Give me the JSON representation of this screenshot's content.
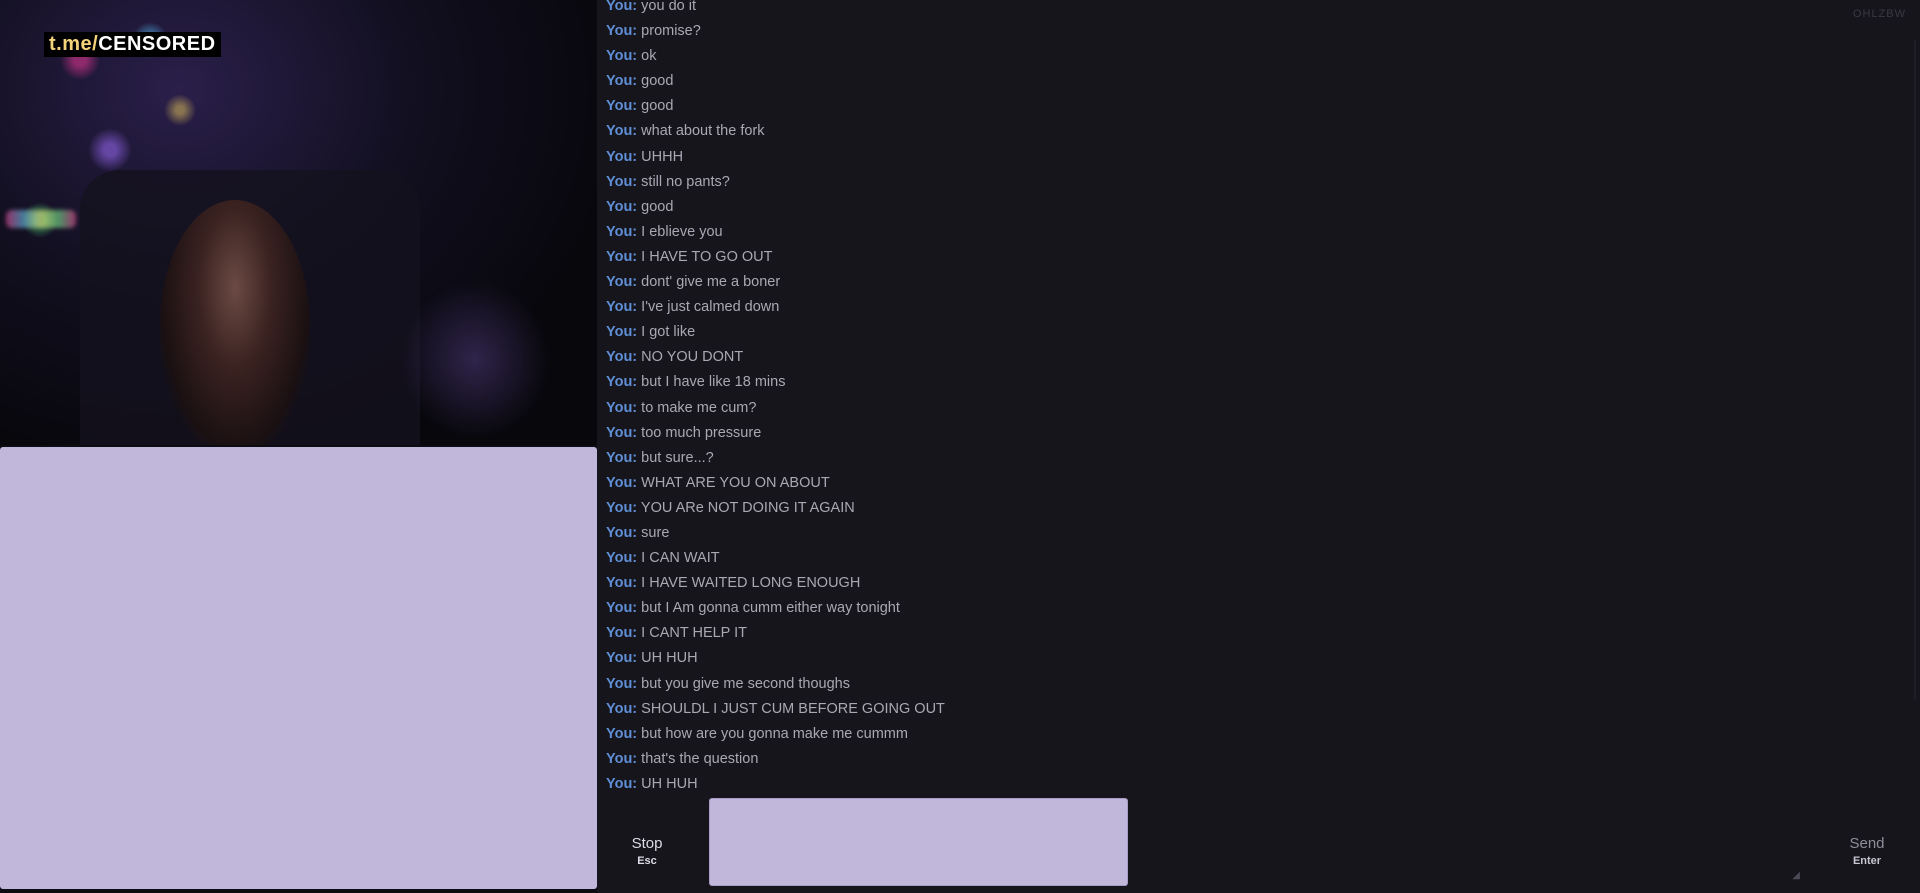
{
  "watermark": {
    "prefix": "t.me/",
    "text": "CENSORED"
  },
  "corner_text": "OHLZBW",
  "chat": {
    "messages": [
      {
        "who": "You:",
        "text": "you do it"
      },
      {
        "who": "You:",
        "text": "promise?"
      },
      {
        "who": "You:",
        "text": "ok"
      },
      {
        "who": "You:",
        "text": "good"
      },
      {
        "who": "You:",
        "text": "good"
      },
      {
        "who": "You:",
        "text": "what about the fork"
      },
      {
        "who": "You:",
        "text": "UHHH"
      },
      {
        "who": "You:",
        "text": "still no pants?"
      },
      {
        "who": "You:",
        "text": "good"
      },
      {
        "who": "You:",
        "text": "I eblieve you"
      },
      {
        "who": "You:",
        "text": "I HAVE TO GO OUT"
      },
      {
        "who": "You:",
        "text": "dont' give me a boner"
      },
      {
        "who": "You:",
        "text": "I've just calmed down"
      },
      {
        "who": "You:",
        "text": "I got like"
      },
      {
        "who": "You:",
        "text": "NO YOU DONT"
      },
      {
        "who": "You:",
        "text": "but I have like 18 mins"
      },
      {
        "who": "You:",
        "text": "to make me cum?"
      },
      {
        "who": "You:",
        "text": "too much pressure"
      },
      {
        "who": "You:",
        "text": "but sure...?"
      },
      {
        "who": "You:",
        "text": "WHAT ARE YOU ON ABOUT"
      },
      {
        "who": "You:",
        "text": "YOU ARe NOT DOING IT AGAIN"
      },
      {
        "who": "You:",
        "text": "sure"
      },
      {
        "who": "You:",
        "text": "I CAN WAIT"
      },
      {
        "who": "You:",
        "text": "I HAVE WAITED LONG ENOUGH"
      },
      {
        "who": "You:",
        "text": "but I Am gonna cumm either way tonight"
      },
      {
        "who": "You:",
        "text": "I CANT HELP IT"
      },
      {
        "who": "You:",
        "text": "UH HUH"
      },
      {
        "who": "You:",
        "text": "but you give me second thoughs"
      },
      {
        "who": "You:",
        "text": "SHOULDL I JUST CUM BEFORE GOING OUT"
      },
      {
        "who": "You:",
        "text": "but how are you gonna make me cummm"
      },
      {
        "who": "You:",
        "text": "that's the question"
      },
      {
        "who": "You:",
        "text": "UH HUH"
      }
    ]
  },
  "composer": {
    "stop_label": "Stop",
    "stop_shortcut": "Esc",
    "message_value": "",
    "send_label": "Send",
    "send_shortcut": "Enter"
  },
  "colors": {
    "background": "#16151c",
    "speaker_label": "#5f8fd6",
    "message_text": "#a9a8b3",
    "self_video_placeholder": "#c0b7da"
  }
}
